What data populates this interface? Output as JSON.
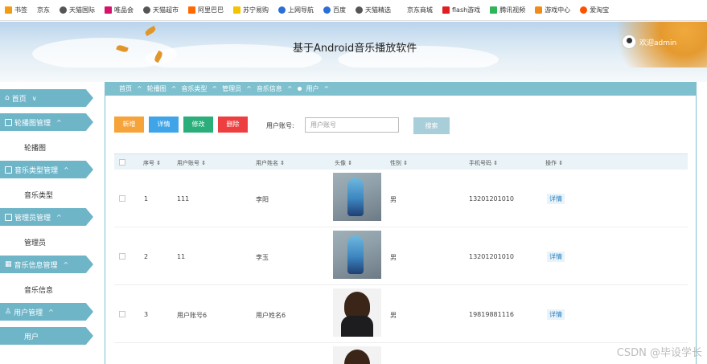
{
  "bookmarks": [
    {
      "label": "书签",
      "color": "#f39c12"
    },
    {
      "label": "京东",
      "color": "#ffffff"
    },
    {
      "label": "天猫国际",
      "color": "#555555"
    },
    {
      "label": "唯品会",
      "color": "#d6136a"
    },
    {
      "label": "天猫超市",
      "color": "#555555"
    },
    {
      "label": "阿里巴巴",
      "color": "#ff6a00"
    },
    {
      "label": "苏宁易购",
      "color": "#f5c400"
    },
    {
      "label": "上网导航",
      "color": "#2a6fd6"
    },
    {
      "label": "百度",
      "color": "#2a6fd6"
    },
    {
      "label": "天猫精选",
      "color": "#555555"
    },
    {
      "label": "京东商城",
      "color": "#ffffff"
    },
    {
      "label": "flash游戏",
      "color": "#e02020"
    },
    {
      "label": "腾讯视频",
      "color": "#2fb55a"
    },
    {
      "label": "游戏中心",
      "color": "#f08a18"
    },
    {
      "label": "爱淘宝",
      "color": "#ff5000"
    }
  ],
  "header": {
    "title": "基于Android音乐播放软件",
    "user": "欢迎admin"
  },
  "sidebar": {
    "groups": [
      {
        "label": "首页",
        "chevron": "∨",
        "items": []
      },
      {
        "label": "轮播图管理",
        "chevron": "^",
        "items": [
          "轮播图"
        ]
      },
      {
        "label": "音乐类型管理",
        "chevron": "^",
        "items": [
          "音乐类型"
        ]
      },
      {
        "label": "管理员管理",
        "chevron": "^",
        "items": [
          "管理员"
        ]
      },
      {
        "label": "音乐信息管理",
        "chevron": "^",
        "items": [
          "音乐信息"
        ]
      },
      {
        "label": "用户管理",
        "chevron": "^",
        "items": [
          "用户"
        ]
      }
    ]
  },
  "breadcrumb": {
    "items": [
      "首页",
      "轮播图",
      "音乐类型",
      "管理员",
      "音乐信息",
      "用户"
    ],
    "separator": "^"
  },
  "toolbar": {
    "add": "新增",
    "detail": "详情",
    "edit": "修改",
    "delete": "删除",
    "search_label": "用户账号:",
    "search_placeholder": "用户账号",
    "search_button": "搜索"
  },
  "table": {
    "columns": [
      "序号",
      "用户账号",
      "用户姓名",
      "头像",
      "性别",
      "手机号码",
      "操作"
    ],
    "rows": [
      {
        "index": "1",
        "account": "111",
        "name": "李阳",
        "avatar": "figure-photo",
        "gender": "男",
        "phone": "13201201010",
        "action": "详情"
      },
      {
        "index": "2",
        "account": "11",
        "name": "李玉",
        "avatar": "figure-photo",
        "gender": "男",
        "phone": "13201201010",
        "action": "详情"
      },
      {
        "index": "3",
        "account": "用户账号6",
        "name": "用户姓名6",
        "avatar": "woman-photo",
        "gender": "男",
        "phone": "19819881116",
        "action": "详情"
      }
    ]
  },
  "watermark": "CSDN @毕设学长"
}
